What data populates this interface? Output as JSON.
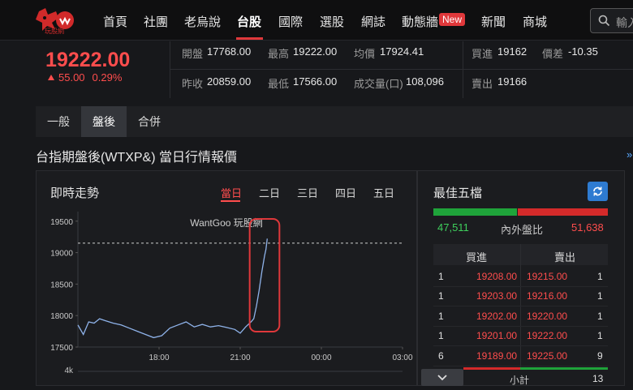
{
  "nav": {
    "logo_text": "玩股網",
    "items": [
      "首頁",
      "社團",
      "老烏說",
      "台股",
      "國際",
      "選股",
      "網誌",
      "動態牆",
      "新聞",
      "商城"
    ],
    "badge_new": "New",
    "search_placeholder": "輸入"
  },
  "quote": {
    "price": "19222.00",
    "change": "55.00",
    "change_pct": "0.29%",
    "rows": {
      "open_label": "開盤",
      "open": "17768.00",
      "high_label": "最高",
      "high": "19222.00",
      "avg_label": "均價",
      "avg": "17924.41",
      "bid_label": "買進",
      "bid": "19162",
      "basis_label": "價差",
      "basis": "-10.35",
      "prev_label": "昨收",
      "prev": "20859.00",
      "low_label": "最低",
      "low": "17566.00",
      "vol_label": "成交量(口)",
      "vol": "108,096",
      "ask_label": "賣出",
      "ask": "19166"
    }
  },
  "subtabs": [
    "一般",
    "盤後",
    "合併"
  ],
  "page_title": "台指期盤後(WTXP&) 當日行情報價",
  "more_link": "»",
  "intraday": {
    "title": "即時走勢",
    "range_tabs": [
      "當日",
      "二日",
      "三日",
      "四日",
      "五日"
    ],
    "watermark": "WantGoo 玩股網",
    "colors": {
      "line": "#8fb3ea",
      "highlight": "#e0383b",
      "ref_line": "#cfcfcf"
    }
  },
  "chart_data": {
    "type": "line",
    "x_ticks": [
      "18:00",
      "21:00",
      "00:00",
      "03:00"
    ],
    "y_ticks": [
      19500,
      19000,
      18500,
      18000,
      17500
    ],
    "ylim": [
      17500,
      19600
    ],
    "volume_tick": "4k",
    "reference_value": 19150,
    "series": [
      {
        "x_hours": [
          15.0,
          15.2,
          15.4,
          15.6,
          15.8,
          16.0,
          16.3,
          16.6,
          16.9,
          17.2,
          17.5,
          17.8,
          18.1,
          18.4,
          18.7,
          19.0,
          19.3,
          19.6,
          19.9,
          20.2,
          20.5,
          20.8,
          21.0,
          21.2,
          21.4,
          21.5,
          21.6,
          21.7,
          21.8,
          21.9,
          21.95,
          22.0
        ],
        "values": [
          17850,
          17700,
          17900,
          17880,
          17950,
          17920,
          17880,
          17850,
          17800,
          17750,
          17700,
          17650,
          17680,
          17800,
          17850,
          17900,
          17820,
          17860,
          17820,
          17840,
          17810,
          17780,
          17720,
          17820,
          17900,
          17950,
          18150,
          18400,
          18700,
          18950,
          19050,
          19222
        ]
      }
    ]
  },
  "orderbook": {
    "title": "最佳五檔",
    "ratio_label": "內外盤比",
    "buy_total": "47,511",
    "sell_total": "51,638",
    "buy_share": 0.479,
    "head_buy": "買進",
    "head_sell": "賣出",
    "rows": [
      {
        "bid_qty": "1",
        "bid": "19208.00",
        "ask": "19215.00",
        "ask_qty": "1"
      },
      {
        "bid_qty": "1",
        "bid": "19203.00",
        "ask": "19216.00",
        "ask_qty": "1"
      },
      {
        "bid_qty": "1",
        "bid": "19202.00",
        "ask": "19220.00",
        "ask_qty": "1"
      },
      {
        "bid_qty": "1",
        "bid": "19201.00",
        "ask": "19222.00",
        "ask_qty": "1"
      },
      {
        "bid_qty": "6",
        "bid": "19189.00",
        "ask": "19225.00",
        "ask_qty": "9"
      }
    ],
    "subtotal_label": "小計",
    "subtotal": "13",
    "colors": {
      "buy": "#1fa33a",
      "sell": "#d42a2a",
      "price": "#ff4d4d"
    }
  }
}
